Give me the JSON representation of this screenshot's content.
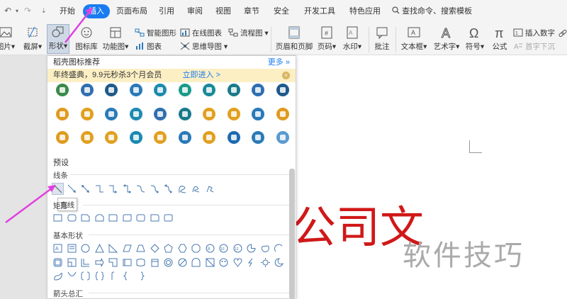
{
  "menubar": {
    "tabs": [
      "开始",
      "插入",
      "页面布局",
      "引用",
      "审阅",
      "视图",
      "章节",
      "安全",
      "开发工具",
      "特色应用"
    ],
    "active_tab": "插入",
    "search_label": "查找命令、搜索模板"
  },
  "ribbon": {
    "picture": "图片",
    "screenshot": "截屏",
    "shape": "形状",
    "icon_lib": "图标库",
    "func_chart": "功能图",
    "smart_shape": "智能图形",
    "chart": "图表",
    "online_chart": "在线图表",
    "mind_map": "思维导图",
    "flowchart": "流程图",
    "header_footer": "页眉和页脚",
    "page_number": "页码",
    "watermark": "水印",
    "comment": "批注",
    "textbox": "文本框",
    "wordart": "艺术字",
    "symbol": "符号",
    "formula": "公式",
    "insert_number": "插入数字",
    "drop_cap": "首字下沉"
  },
  "panel": {
    "title": "稻壳图标推荐",
    "more": "更多",
    "promo_text": "年终盛典，9.9元秒杀3个月会员",
    "promo_link": "立即进入 >",
    "preset": "预设",
    "lines": "线条",
    "rect": "矩形",
    "basic": "基本形状",
    "arrows": "箭头总汇",
    "tooltip": "直线"
  },
  "document": {
    "red_text": "公司文",
    "watermark": "软件技巧"
  },
  "colors": {
    "accent": "#1a7cf0",
    "promo_bg": "#fcefc4",
    "doc_red": "#d01818",
    "arrow": "#e040e0"
  },
  "icon_colors": [
    [
      "#3a8a4a",
      "#2f6fb0",
      "#1e5a8a",
      "#2a7ab8",
      "#1e8ab0",
      "#1a9a8a",
      "#1a8a9a",
      "#1a7a8a",
      "#2f6fb0",
      "#1e5a8a"
    ],
    [
      "#e09a20",
      "#e0a020",
      "#2a7ab8",
      "#1e8ab0",
      "#2f6fb0",
      "#1a7a8a",
      "#e0a020",
      "#e0a020",
      "#2a7ab8",
      "#e09a20"
    ],
    [
      "#e09a20",
      "#e0a020",
      "#e0a020",
      "#1a8ab0",
      "#e0a020",
      "#2a7ab8",
      "#e0a020",
      "#1e6ab0",
      "#2a7ab8",
      "#5a9ad0"
    ]
  ]
}
